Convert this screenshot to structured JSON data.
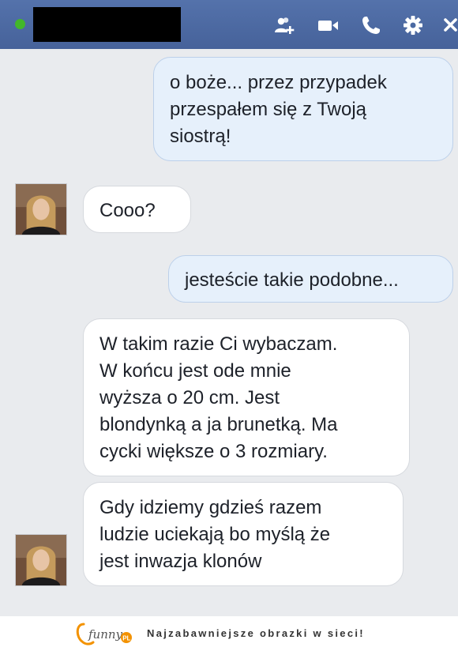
{
  "header": {
    "status": "online",
    "icons": [
      "add-friend-icon",
      "video-call-icon",
      "phone-icon",
      "gear-icon",
      "close-icon"
    ]
  },
  "messages": [
    {
      "side": "sent",
      "lines": [
        "o boże... przez przypadek",
        "przespałem się z Twoją",
        "siostrą!"
      ]
    },
    {
      "side": "received",
      "lines": [
        "Cooo?"
      ]
    },
    {
      "side": "sent",
      "lines": [
        "jesteście takie podobne..."
      ]
    },
    {
      "side": "received",
      "lines": [
        "W takim razie Ci wybaczam.",
        "W końcu jest ode mnie",
        "wyższa o 20 cm. Jest",
        "blondynką a ja brunetką. Ma",
        "cycki większe o 3 rozmiary."
      ]
    },
    {
      "side": "received",
      "lines": [
        "Gdy idziemy gdzieś razem",
        "ludzie uciekają bo myślą że",
        "jest inwazja klonów"
      ]
    }
  ],
  "footer": {
    "logo_text": "funny",
    "logo_suffix": "PL",
    "tagline": "Najzabawniejsze obrazki w sieci!"
  },
  "colors": {
    "header": "#4b6aa3",
    "chat_background": "#e9ebee",
    "sent_bubble": "#e6f0fb",
    "received_bubble": "#ffffff",
    "online": "#42b72a"
  }
}
